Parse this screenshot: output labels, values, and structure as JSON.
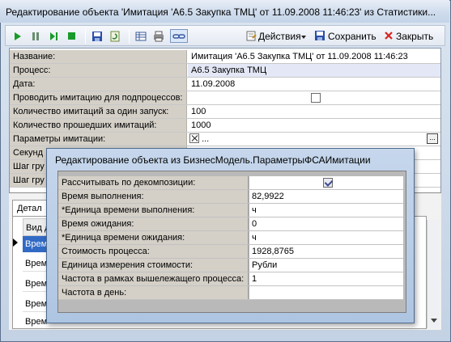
{
  "window": {
    "title": "Редактирование объекта 'Имитация 'А6.5 Закупка ТМЦ' от 11.09.2008 11:46:23' из Статистики..."
  },
  "toolbar": {
    "actions_label": "Действия",
    "save_label": "Сохранить",
    "close_label": "Закрыть"
  },
  "properties": [
    {
      "label": "Название:",
      "value": "Имитация 'А6.5 Закупка ТМЦ' от 11.09.2008 11:46:23"
    },
    {
      "label": "Процесс:",
      "value": "А6.5 Закупка ТМЦ"
    },
    {
      "label": "Дата:",
      "value": "11.09.2008"
    },
    {
      "label": "Проводить имитацию для подпроцессов:",
      "value": ""
    },
    {
      "label": "Количество имитаций за один запуск:",
      "value": "100"
    },
    {
      "label": "Количество прошедших имитаций:",
      "value": "1000"
    },
    {
      "label": "Параметры имитации:",
      "value": "..."
    },
    {
      "label": "Секунд",
      "value": ""
    },
    {
      "label": "Шаг гру",
      "value": ""
    },
    {
      "label": "Шаг гру",
      "value": ""
    }
  ],
  "tabs": {
    "details_label": "Детал",
    "col_header": "Вид д",
    "rows": [
      "Врем",
      "Врем",
      "Врем",
      "Врем",
      "Врем"
    ]
  },
  "dialog": {
    "title": "Редактирование объекта  из БизнесМодель.ПараметрыФСАИмитации",
    "rows": [
      {
        "label": "Рассчитывать по декомпозиции:",
        "value": ""
      },
      {
        "label": "Время выполнения:",
        "value": "82,9922"
      },
      {
        "label": "*Единица времени выполнения:",
        "value": "ч"
      },
      {
        "label": "Время ожидания:",
        "value": "0"
      },
      {
        "label": "*Единица времени ожидания:",
        "value": "ч"
      },
      {
        "label": "Стоимость процесса:",
        "value": "1928,8765"
      },
      {
        "label": "Единица измерения стоимости:",
        "value": "Рубли"
      },
      {
        "label": "Частота в рамках вышележащего процесса:",
        "value": "1"
      },
      {
        "label": "Частота в день:",
        "value": ""
      }
    ]
  }
}
